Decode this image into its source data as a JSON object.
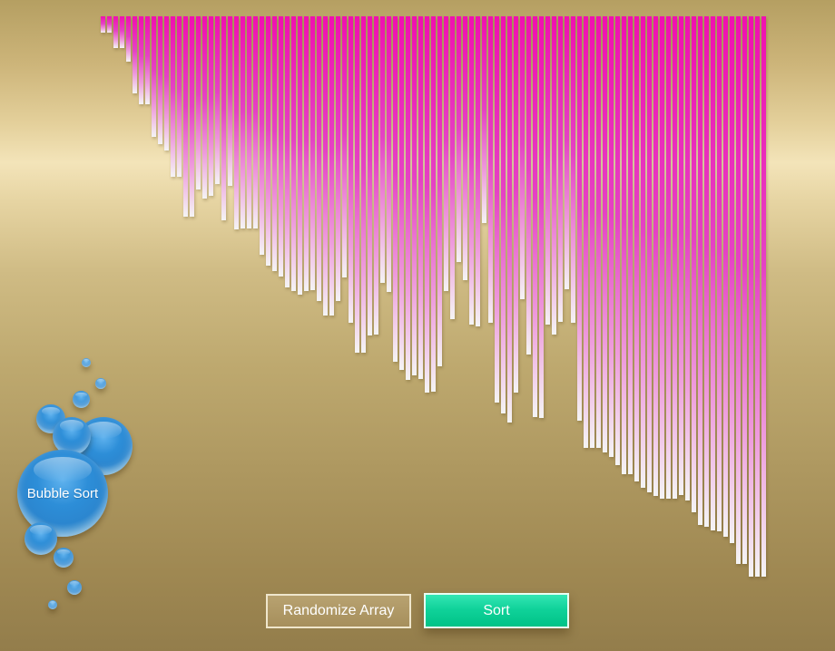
{
  "app": {
    "title_bubble_label": "Bubble Sort"
  },
  "controls": {
    "randomize_label": "Randomize Array",
    "sort_label": "Sort"
  },
  "colors": {
    "bar_top": "#f010b0",
    "bar_bottom": "#f4f4f4",
    "sort_button": "#10d29a",
    "bubble": "#2d8ed8"
  },
  "array_values": [
    18,
    18,
    35,
    35,
    50,
    85,
    97,
    97,
    133,
    141,
    148,
    177,
    177,
    221,
    221,
    191,
    201,
    198,
    185,
    225,
    187,
    235,
    234,
    234,
    234,
    263,
    275,
    281,
    287,
    299,
    303,
    307,
    303,
    302,
    314,
    330,
    330,
    314,
    288,
    338,
    371,
    371,
    352,
    351,
    294,
    304,
    381,
    390,
    401,
    396,
    400,
    415,
    414,
    386,
    303,
    334,
    271,
    291,
    340,
    342,
    228,
    338,
    426,
    438,
    448,
    415,
    312,
    373,
    442,
    443,
    340,
    351,
    337,
    301,
    338,
    446,
    476,
    476,
    476,
    481,
    486,
    495,
    505,
    505,
    513,
    520,
    525,
    529,
    532,
    532,
    532,
    528,
    534,
    547,
    561,
    563,
    567,
    568,
    574,
    581,
    604,
    604,
    618,
    618,
    618
  ]
}
